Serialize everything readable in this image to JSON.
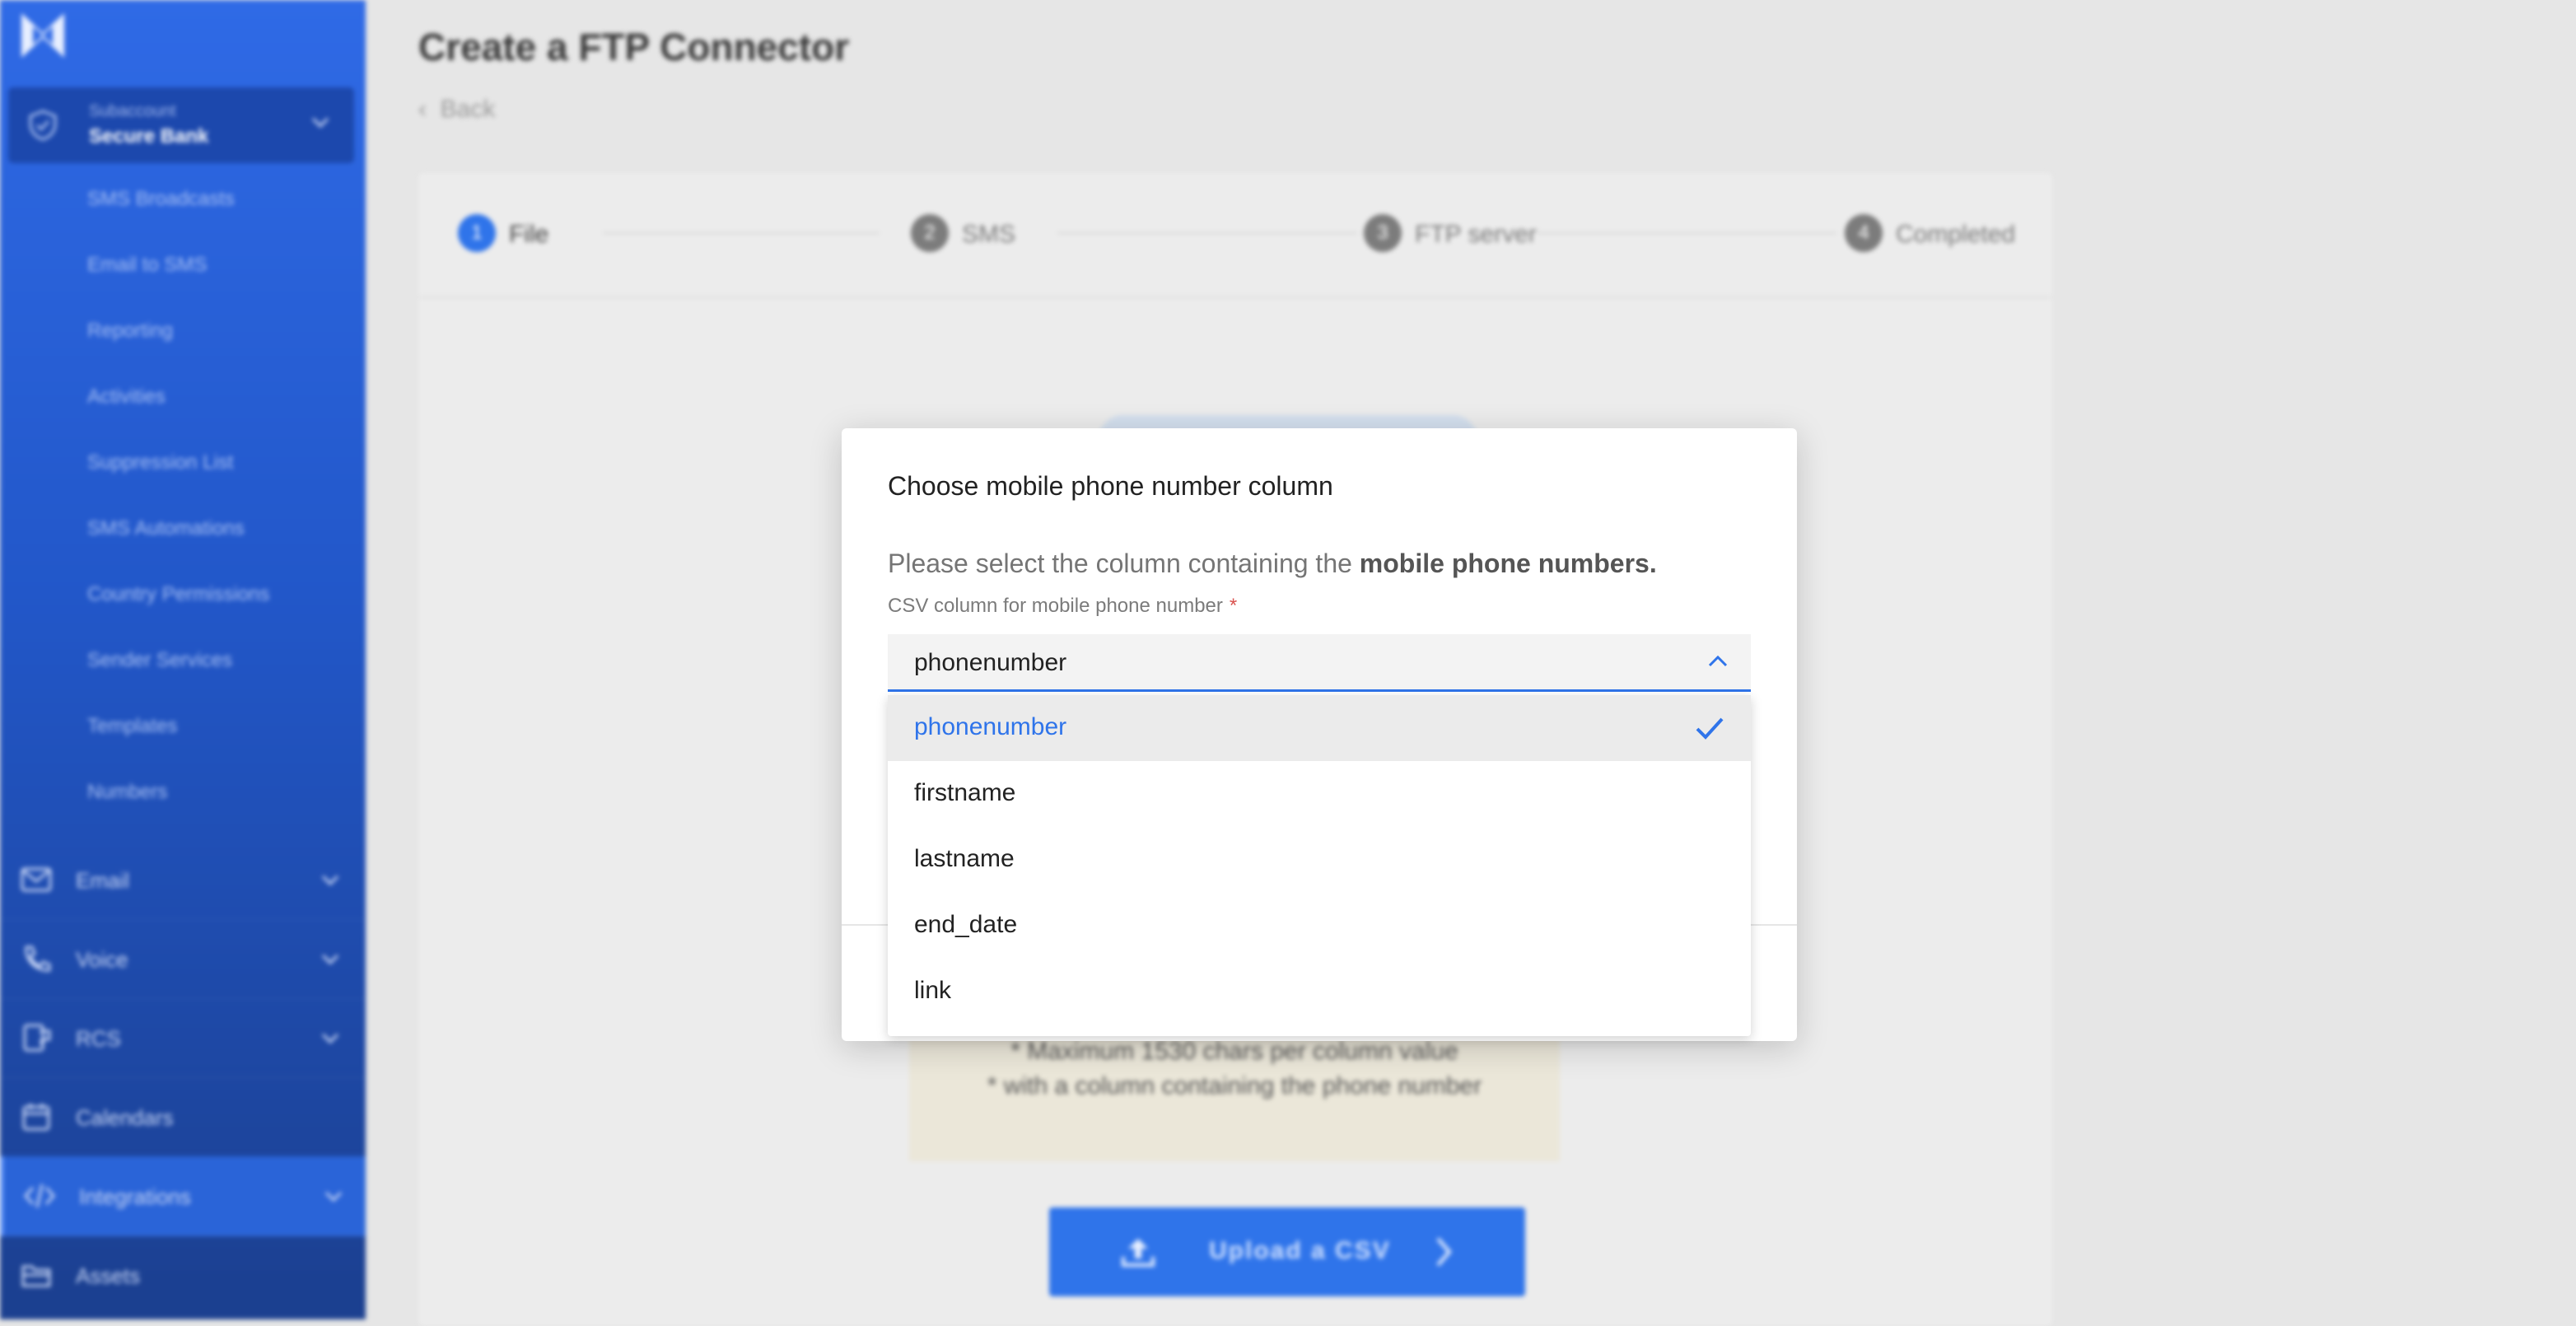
{
  "sidebar": {
    "subaccount_label": "Subaccount",
    "subaccount_name": "Secure Bank",
    "sms_items": [
      "SMS Broadcasts",
      "Email to SMS",
      "Reporting",
      "Activities",
      "Suppression List",
      "SMS Automations",
      "Country Permissions",
      "Sender Services",
      "Templates",
      "Numbers"
    ],
    "nav": [
      {
        "label": "Email",
        "icon": "envelope-icon"
      },
      {
        "label": "Voice",
        "icon": "phone-icon"
      },
      {
        "label": "RCS",
        "icon": "rcs-icon"
      },
      {
        "label": "Calendars",
        "icon": "calendar-icon"
      },
      {
        "label": "Integrations",
        "icon": "code-icon"
      },
      {
        "label": "Assets",
        "icon": "folder-icon"
      }
    ]
  },
  "page": {
    "title": "Create a FTP Connector",
    "back_label": "Back",
    "steps": [
      {
        "num": "1",
        "label": "File"
      },
      {
        "num": "2",
        "label": "SMS"
      },
      {
        "num": "3",
        "label": "FTP server"
      },
      {
        "num": "4",
        "label": "Completed"
      }
    ],
    "info_lines": [
      "* Maximum 1530 chars per column value",
      "* with a column containing the phone number"
    ],
    "upload_label": "Upload a CSV"
  },
  "dialog": {
    "title": "Choose mobile phone number column",
    "desc_prefix": "Please select the column containing the",
    "desc_bold": "mobile phone numbers.",
    "field_label": "CSV column for mobile phone number",
    "required_mark": "*",
    "selected_value": "phonenumber",
    "options": [
      "phonenumber",
      "firstname",
      "lastname",
      "end_date",
      "link"
    ]
  },
  "colors": {
    "accent": "#2f74ea",
    "sidebar": "#2257c9",
    "required": "#d9534f"
  }
}
